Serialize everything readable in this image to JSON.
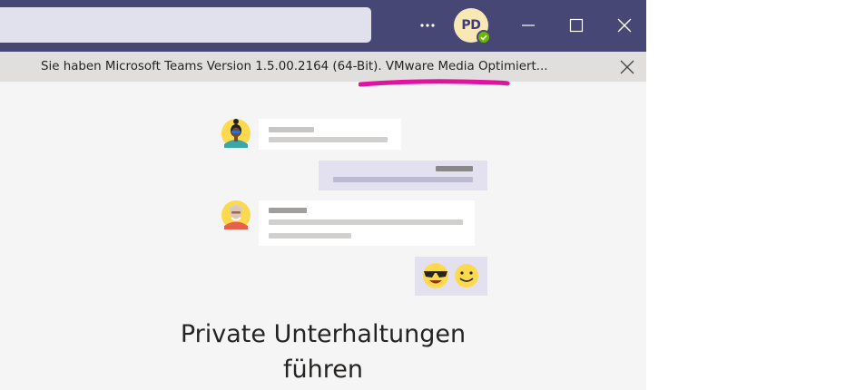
{
  "titlebar": {
    "avatar_initials": "PD",
    "more_label": "...",
    "presence_color": "#6bb700"
  },
  "notice": {
    "text": "Sie haben Microsoft Teams Version 1.5.00.2164 (64-Bit). VMware Media Optimiert..."
  },
  "illustration": {
    "emojis": [
      "😎",
      "🙂"
    ]
  },
  "main": {
    "heading_line1": "Private Unterhaltungen",
    "heading_line2": "führen"
  },
  "colors": {
    "titlebar_bg": "#464775",
    "highlight": "#e0139f",
    "bubble_purple": "#e3e1f0"
  }
}
